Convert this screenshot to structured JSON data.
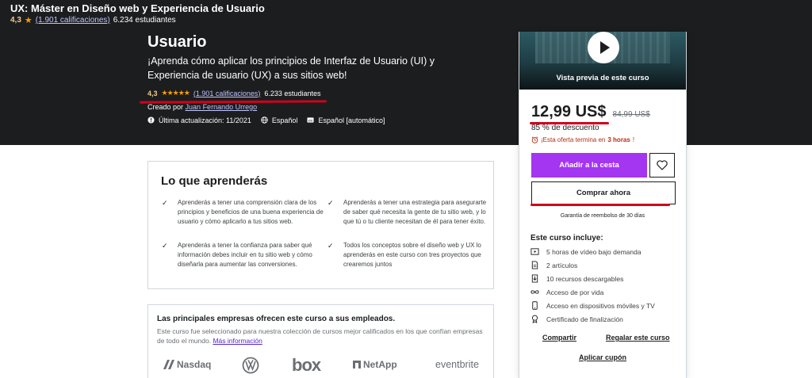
{
  "sticky_header": {
    "title": "UX: Máster en Diseño web y Experiencia de Usuario",
    "rating": "4,3",
    "ratings_link": "(1.901 calificaciones)",
    "students": "6.234 estudiantes"
  },
  "hero": {
    "title": "Usuario",
    "subtitle": "¡Aprenda cómo aplicar los principios de Interfaz de Usuario (UI) y Experiencia de usuario (UX) a sus sitios web!",
    "rating": "4,3",
    "stars": "★★★★★",
    "ratings_link": "(1.901 calificaciones)",
    "students": "6.233 estudiantes",
    "created_by_label": "Creado por",
    "instructor": "Juan Fernando Urrego",
    "last_update": "Última actualización: 11/2021",
    "language": "Español",
    "captions": "Español [automático]"
  },
  "learn": {
    "title": "Lo que aprenderás",
    "items": [
      "Aprenderás a tener una comprensión clara de los principios y beneficios de una buena experiencia de usuario y cómo aplicarlo a tus sitios web.",
      "Aprenderás a tener una estrategia para asegurarte de saber qué necesita la gente de tu sitio web, y lo que tú o tu cliente necesitan de él para tener éxito.",
      "Aprenderás a tener la confianza para saber qué información debes incluir en tu sitio web y cómo diseñarla para aumentar las conversiones.",
      "Todos los conceptos sobre el diseño web y UX lo aprenderás en este curso con tres proyectos que crearemos juntos"
    ]
  },
  "companies": {
    "title": "Las principales empresas ofrecen este curso a sus empleados.",
    "description": "Este curso fue seleccionado para nuestra colección de cursos mejor calificados en los que confían empresas de todo el mundo.",
    "more_link": "Más información",
    "logos": [
      "Nasdaq",
      "VW",
      "box",
      "NetApp",
      "eventbrite"
    ]
  },
  "card": {
    "preview_label": "Vista previa de este curso",
    "price": "12,99 US$",
    "original_price": "84,99 US$",
    "discount": "85 % de descuento",
    "offer_prefix": "¡Esta oferta termina en",
    "offer_time": "3 horas",
    "offer_suffix": "!",
    "add_to_cart": "Añadir a la cesta",
    "buy_now": "Comprar ahora",
    "guarantee": "Garantía de reembolso de 30 días",
    "includes_title": "Este curso incluye:",
    "includes": [
      {
        "icon": "video-icon",
        "text": "5 horas de vídeo bajo demanda"
      },
      {
        "icon": "article-icon",
        "text": "2 artículos"
      },
      {
        "icon": "download-icon",
        "text": "10 recursos descargables"
      },
      {
        "icon": "infinity-icon",
        "text": "Acceso de por vida"
      },
      {
        "icon": "mobile-icon",
        "text": "Acceso en dispositivos móviles y TV"
      },
      {
        "icon": "certificate-icon",
        "text": "Certificado de finalización"
      }
    ],
    "share": "Compartir",
    "gift": "Regalar este curso",
    "coupon": "Aplicar cupón"
  },
  "colors": {
    "dark_bg": "#1c1d1f",
    "purple": "#a435f0",
    "star": "#f69c08",
    "annotation_red": "#d0021b"
  }
}
